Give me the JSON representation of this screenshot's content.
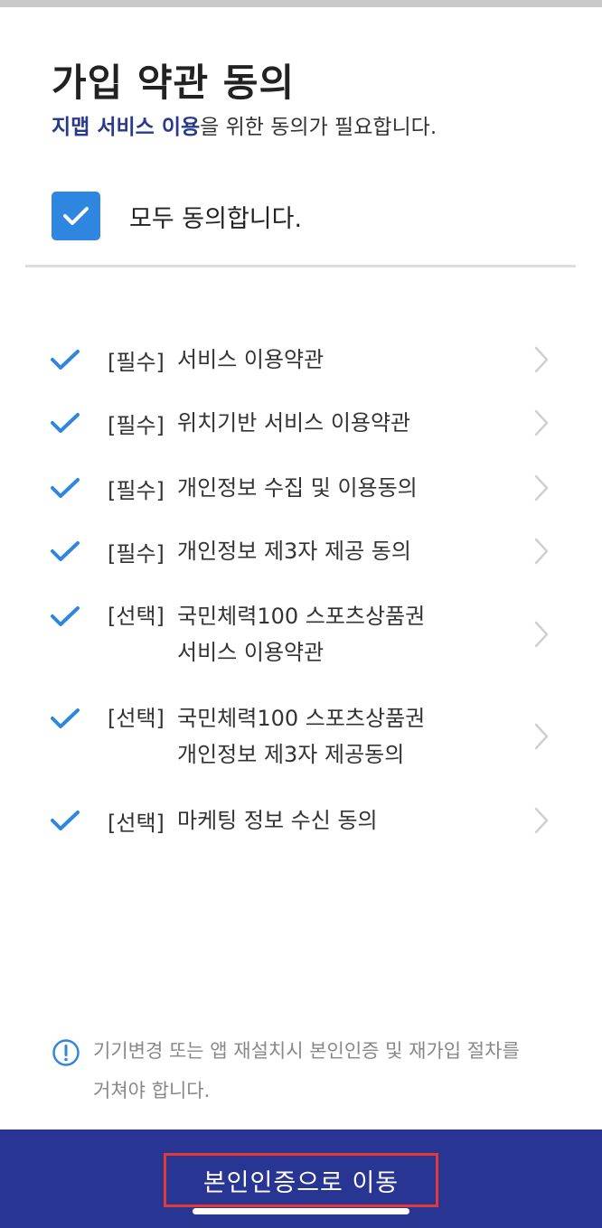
{
  "header": {
    "title": "가입 약관 동의",
    "subtitle_highlight": "지맵 서비스 이용",
    "subtitle_rest": "을 위한 동의가 필요합니다."
  },
  "agree_all": {
    "label": "모두 동의합니다.",
    "checked": true
  },
  "terms": [
    {
      "tag": "[필수]",
      "lines": [
        "서비스 이용약관"
      ]
    },
    {
      "tag": "[필수]",
      "lines": [
        "위치기반 서비스 이용약관"
      ]
    },
    {
      "tag": "[필수]",
      "lines": [
        "개인정보 수집 및 이용동의"
      ]
    },
    {
      "tag": "[필수]",
      "lines": [
        "개인정보 제3자 제공 동의"
      ]
    },
    {
      "tag": "[선택]",
      "lines": [
        "국민체력100 스포츠상품권",
        "서비스 이용약관"
      ]
    },
    {
      "tag": "[선택]",
      "lines": [
        "국민체력100 스포츠상품권",
        "개인정보 제3자 제공동의"
      ]
    },
    {
      "tag": "[선택]",
      "lines": [
        "마케팅 정보 수신 동의"
      ]
    }
  ],
  "notice": {
    "icon": "info-circle-icon",
    "text": "기기변경 또는 앱 재설치시 본인인증 및 재가입 절차를 거쳐야 합니다."
  },
  "footer": {
    "button_label": "본인인증으로 이동"
  },
  "colors": {
    "accent_blue": "#2f86e0",
    "highlight_navy": "#283a8c",
    "footer_bar": "#283593",
    "callout_red": "#e53935"
  }
}
